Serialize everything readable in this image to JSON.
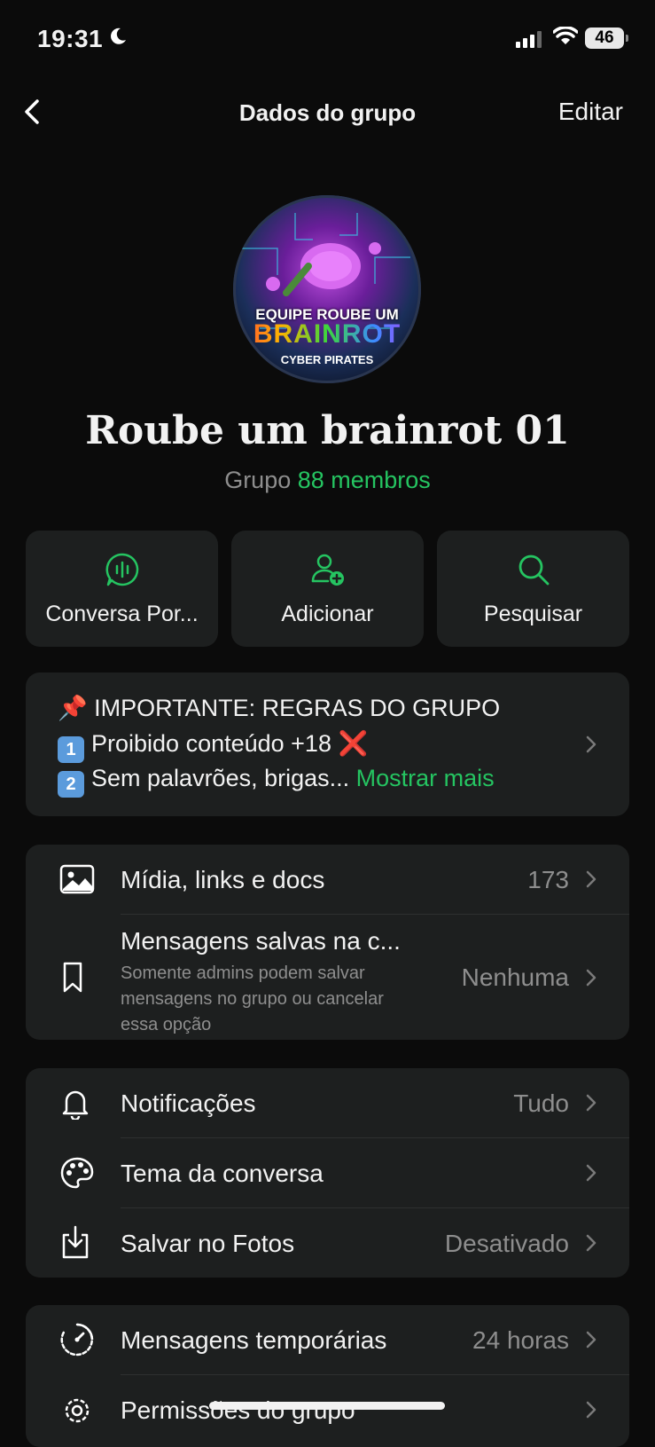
{
  "status": {
    "time": "19:31",
    "battery": "46"
  },
  "nav": {
    "title": "Dados do grupo",
    "edit": "Editar"
  },
  "avatar": {
    "line1": "EQUIPE ROUBE UM",
    "line2": "BRAINROT",
    "line3": "CYBER PIRATES"
  },
  "group": {
    "name": "Roube um brainrot 01",
    "type": "Grupo",
    "members": "88 membros"
  },
  "actions": [
    {
      "label": "Conversa Por...",
      "icon": "voice-chat-icon"
    },
    {
      "label": "Adicionar",
      "icon": "add-person-icon"
    },
    {
      "label": "Pesquisar",
      "icon": "search-icon"
    }
  ],
  "description": {
    "line1": "📌 IMPORTANTE: REGRAS DO GRUPO",
    "line2_num": "1",
    "line2": "Proibido conteúdo +18 ❌",
    "line3_num": "2",
    "line3": "Sem palavrões, brigas...",
    "more": "Mostrar mais"
  },
  "section1": {
    "media": {
      "label": "Mídia, links e docs",
      "value": "173"
    },
    "saved": {
      "label": "Mensagens salvas na c...",
      "sub": "Somente admins podem salvar mensagens no grupo ou cancelar essa opção",
      "value": "Nenhuma"
    }
  },
  "section2": {
    "notifications": {
      "label": "Notificações",
      "value": "Tudo"
    },
    "theme": {
      "label": "Tema da conversa"
    },
    "save_photos": {
      "label": "Salvar no Fotos",
      "value": "Desativado"
    }
  },
  "section3": {
    "temp": {
      "label": "Mensagens temporárias",
      "value": "24 horas"
    },
    "permissions": {
      "label": "Permissões do grupo"
    }
  },
  "colors": {
    "accent": "#25c461",
    "background": "#0b0b0b",
    "card": "#1d1f1f"
  }
}
